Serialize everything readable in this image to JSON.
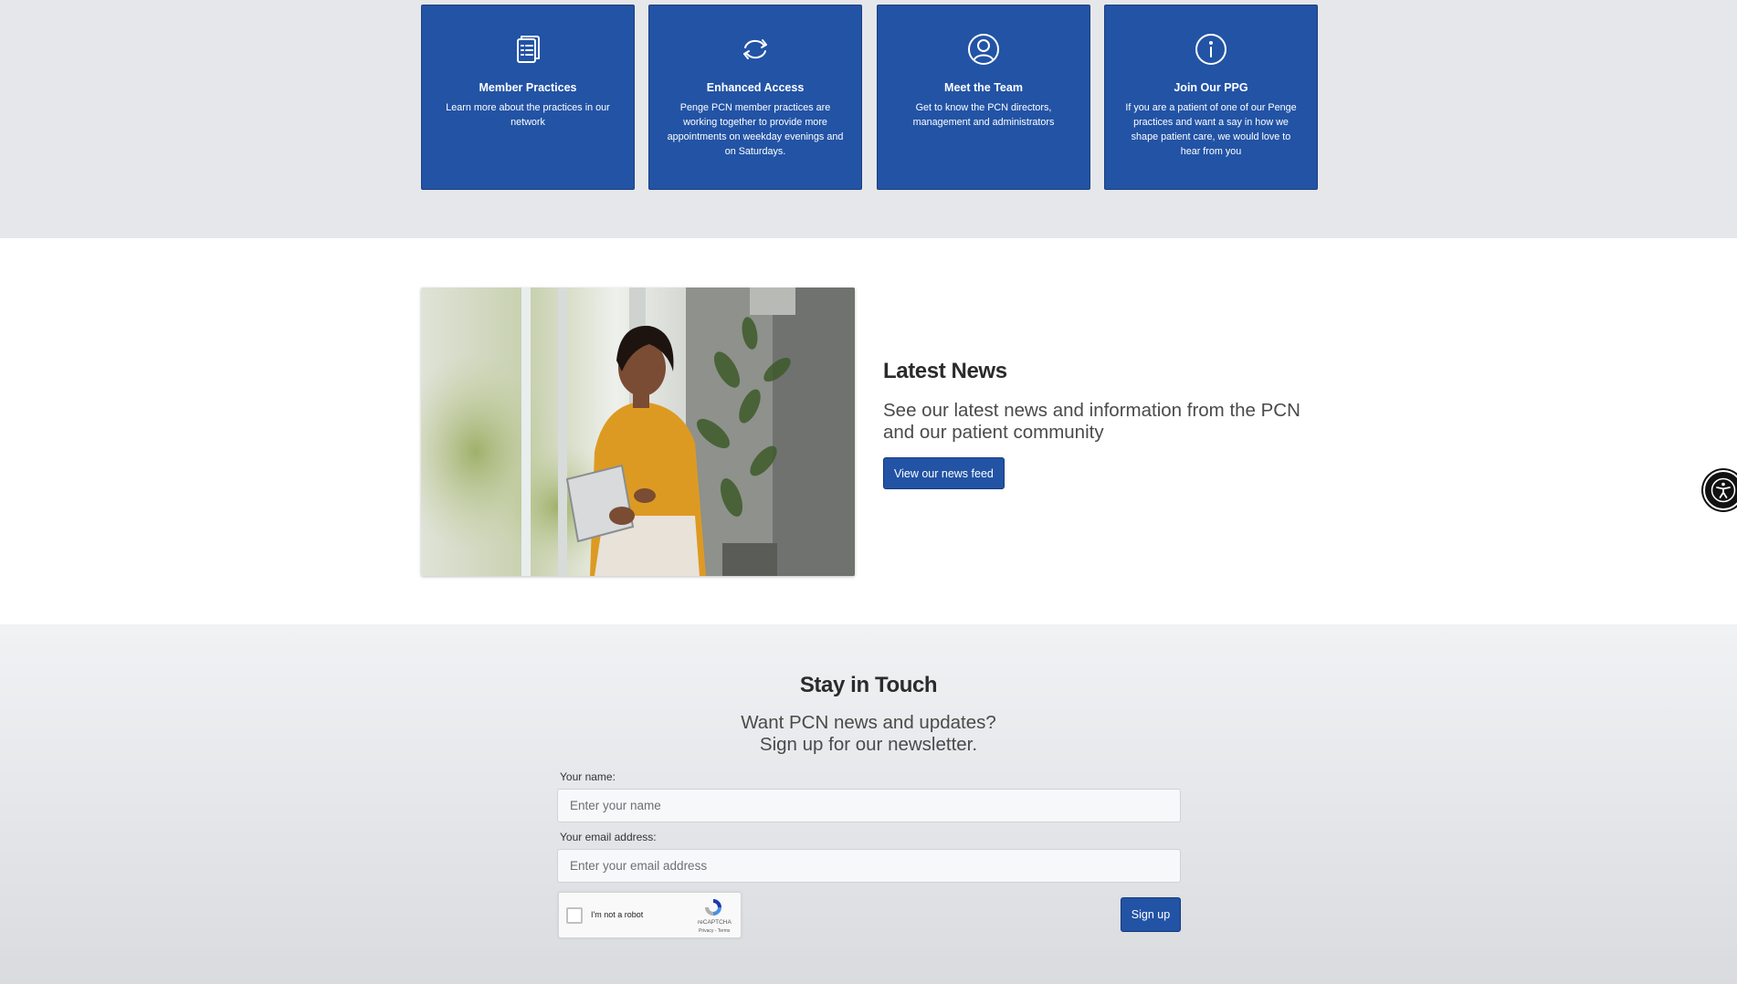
{
  "cards": [
    {
      "icon": "clipboard-icon",
      "title": "Member Practices",
      "text": "Learn more about the practices in our network"
    },
    {
      "icon": "refresh-icon",
      "title": "Enhanced Access",
      "text": "Penge PCN member practices are working together to provide more appointments on weekday evenings and on Saturdays."
    },
    {
      "icon": "user-circle-icon",
      "title": "Meet the Team",
      "text": "Get to know the PCN directors, management and administrators"
    },
    {
      "icon": "info-icon",
      "title": "Join Our PPG",
      "text": "If you are a patient of one of our Penge practices and want a say in how we shape patient care, we would love to hear from you"
    }
  ],
  "news": {
    "title": "Latest News",
    "lead": "See our latest news and information from the PCN and our patient community",
    "button_label": "View our news feed"
  },
  "newsletter": {
    "title": "Stay in Touch",
    "subtitle_line1": "Want PCN news and updates?",
    "subtitle_line2": "Sign up for our newsletter.",
    "name_label": "Your name:",
    "name_placeholder": "Enter your name",
    "email_label": "Your email address:",
    "email_placeholder": "Enter your email address",
    "recaptcha_label": "I'm not a robot",
    "recaptcha_brand": "reCAPTCHA",
    "recaptcha_terms": "Privacy - Terms",
    "signup_label": "Sign up"
  },
  "colors": {
    "primary_blue": "#2253a5",
    "section_grey": "#e6e7ea",
    "accessibility_widget": "#111111"
  }
}
